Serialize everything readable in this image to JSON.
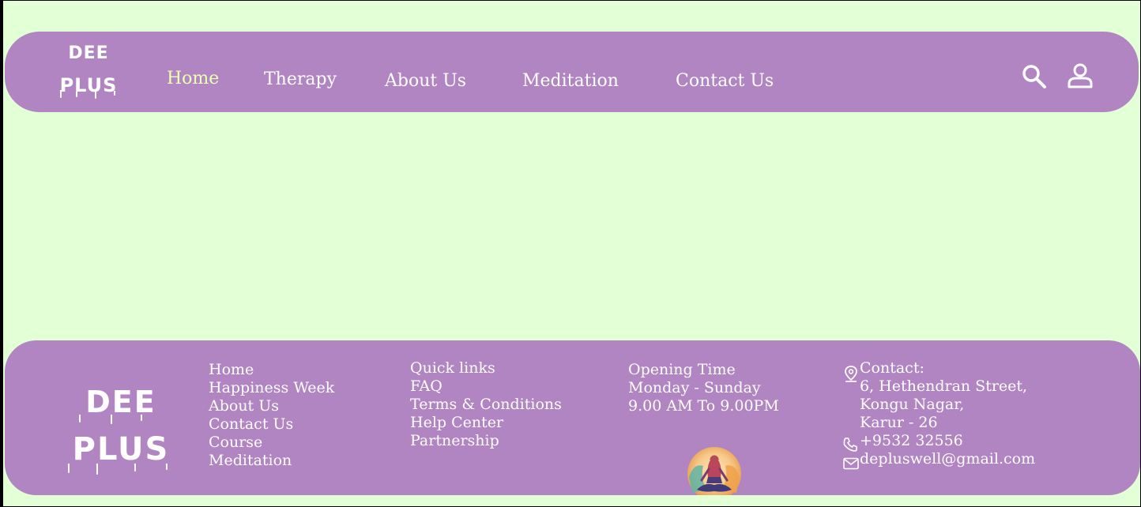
{
  "brand": {
    "line1": "DEE",
    "line2": "PLUS"
  },
  "nav": {
    "items": [
      {
        "label": "Home",
        "active": true
      },
      {
        "label": "Therapy",
        "active": false
      },
      {
        "label": "About Us",
        "active": false
      },
      {
        "label": "Meditation",
        "active": false
      },
      {
        "label": "Contact Us",
        "active": false
      }
    ],
    "icons": [
      "search-icon",
      "user-icon"
    ]
  },
  "footer": {
    "links_col1": [
      "Home",
      "Happiness Week",
      "About Us",
      "Contact Us",
      "Course",
      "Meditation"
    ],
    "quick_links": {
      "heading": "Quick links",
      "items": [
        "FAQ",
        "Terms & Conditions",
        "Help Center",
        "Partnership"
      ]
    },
    "opening": {
      "heading": "Opening Time",
      "days": "Monday - Sunday",
      "hours": "9.00 AM To 9.00PM"
    },
    "contact": {
      "heading": "Contact:",
      "address_lines": [
        "6, Hethendran Street,",
        "Kongu Nagar,",
        "Karur - 26"
      ],
      "phone": "+9532 32556",
      "email": "depluswell@gmail.com"
    },
    "icons": [
      "location-pin-icon",
      "phone-icon",
      "mail-icon",
      "meditation-emblem"
    ]
  },
  "colors": {
    "page_background": "#e2ffd6",
    "bar_background": "#b185c1",
    "text": "#ffffff",
    "active_link": "#ecffb0"
  }
}
